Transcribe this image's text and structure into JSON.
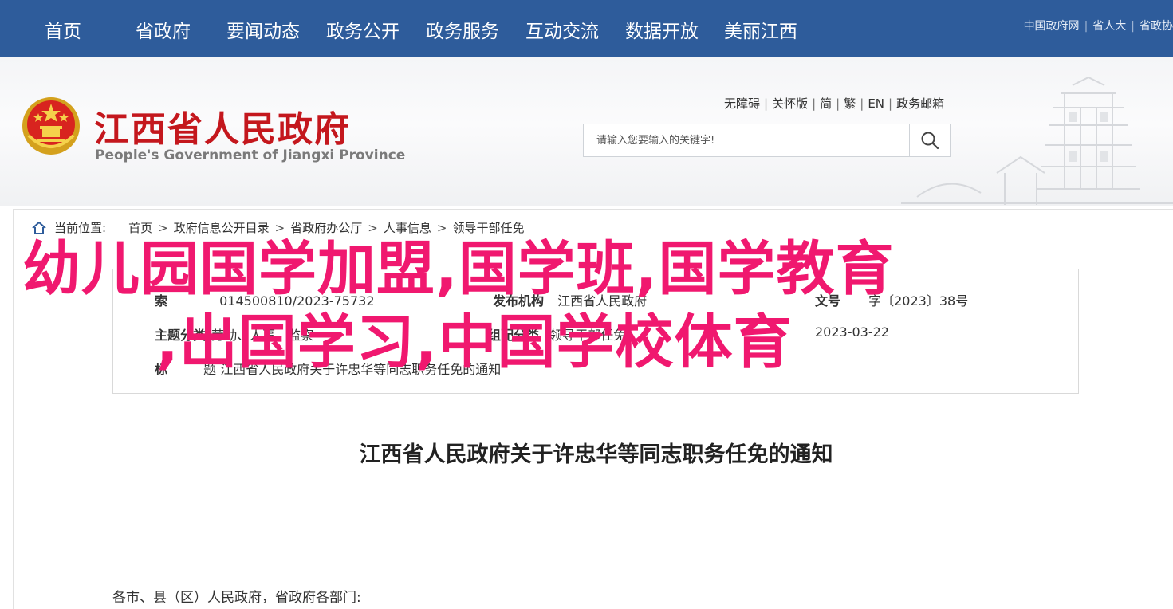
{
  "topnav": {
    "items": [
      "首页",
      "省政府",
      "要闻动态",
      "政务公开",
      "政务服务",
      "互动交流",
      "数据开放",
      "美丽江西"
    ],
    "right_links": [
      "中国政府网",
      "省人大",
      "省政协"
    ]
  },
  "header": {
    "logo_cn": "江西省人民政府",
    "logo_en": "People's Government of Jiangxi Province",
    "util_links": [
      "无障碍",
      "关怀版",
      "简",
      "繁",
      "EN",
      "政务邮箱"
    ],
    "search": {
      "placeholder": "请输入您要输入的关键字!"
    }
  },
  "breadcrumb": {
    "label": "当前位置:",
    "items": [
      "首页",
      "政府信息公开目录",
      "省政府办公厅",
      "人事信息",
      "领导干部任免"
    ]
  },
  "meta": {
    "index_label": "索",
    "index_value": "014500810/2023-75732",
    "issuer_label": "发布机构",
    "issuer_value": "江西省人民政府",
    "doc_no_label": "文号",
    "doc_no_value": "字〔2023〕38号",
    "topic_label": "主题分类",
    "topic_value": "劳动、人事、监察",
    "category_label": "组配分类",
    "category_value": "领导干部任免",
    "date_value": "2023-03-22",
    "title_label": "标",
    "title_value": "题 江西省人民政府关于许忠华等同志职务任免的通知"
  },
  "overlay": {
    "line1": "幼儿园国学加盟,国学班,国学教育",
    "line2": ",出国学习,中国学校体育"
  },
  "article": {
    "title": "江西省人民政府关于许忠华等同志职务任免的通知",
    "salutation": "各市、县（区）人民政府，省政府各部门:"
  },
  "colors": {
    "nav_bg": "#2e5c9b",
    "logo_red": "#c4171d",
    "overlay_pink": "#f0186f"
  }
}
